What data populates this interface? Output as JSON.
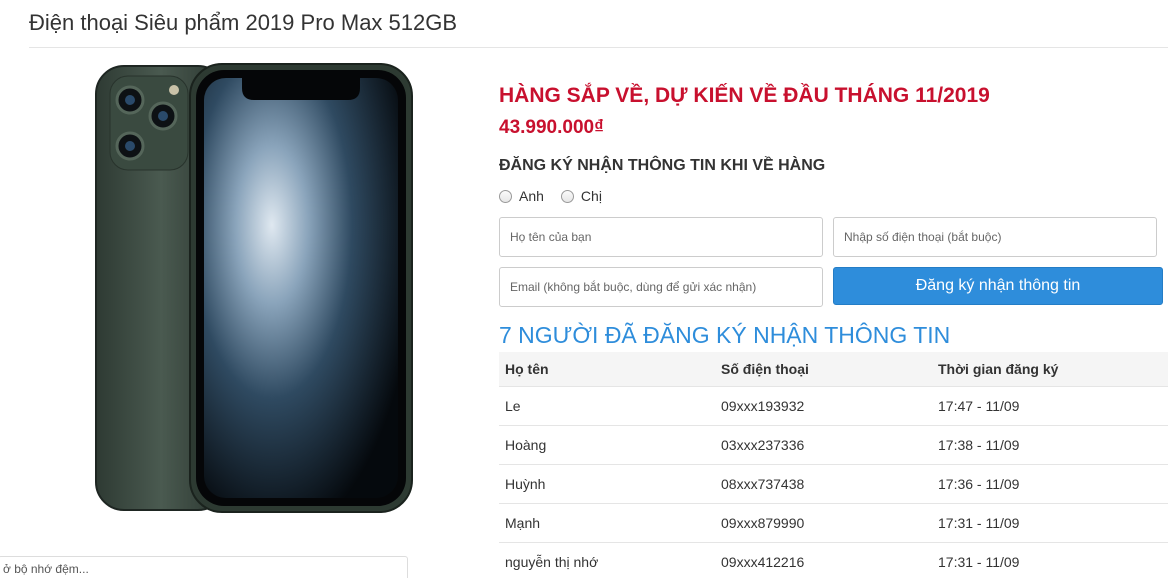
{
  "product": {
    "title": "Điện thoại Siêu phẩm 2019 Pro Max 512GB",
    "status": "HÀNG SẮP VỀ, DỰ KIẾN VỀ ĐẦU THÁNG 11/2019",
    "price": "43.990.000₫"
  },
  "form": {
    "heading": "ĐĂNG KÝ NHẬN THÔNG TIN KHI VỀ HÀNG",
    "gender_options": [
      "Anh",
      "Chị"
    ],
    "name_placeholder": "Họ tên của bạn",
    "phone_placeholder": "Nhập số điện thoại (bắt buộc)",
    "email_placeholder": "Email (không bắt buộc, dùng để gửi xác nhận)",
    "submit_label": "Đăng ký nhận thông tin"
  },
  "registrations": {
    "heading": "7 NGƯỜI ĐÃ ĐĂNG KÝ NHẬN THÔNG TIN",
    "columns": [
      "Họ tên",
      "Số điện thoại",
      "Thời gian đăng ký"
    ],
    "rows": [
      [
        "Le",
        "09xxx193932",
        "17:47 - 11/09"
      ],
      [
        "Hoàng",
        "03xxx237336",
        "17:38 - 11/09"
      ],
      [
        "Huỳnh",
        "08xxx737438",
        "17:36 - 11/09"
      ],
      [
        "Mạnh",
        "09xxx879990",
        "17:31 - 11/09"
      ],
      [
        "nguyễn thị nhớ",
        "09xxx412216",
        "17:31 - 11/09"
      ]
    ]
  },
  "cache_box": {
    "text": "ở bộ nhớ đệm..."
  },
  "colors": {
    "status_red": "#c8102e",
    "accent_blue": "#2e8ddb",
    "phone_green": "#3d4d43"
  }
}
